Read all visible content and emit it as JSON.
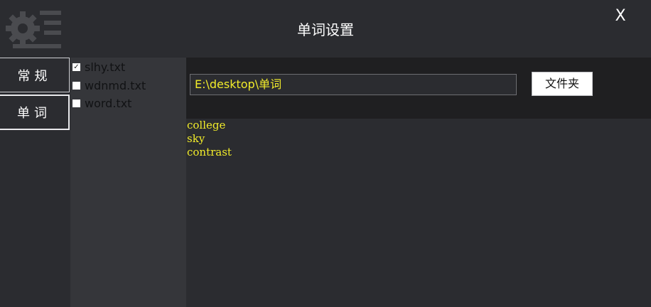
{
  "window": {
    "title": "单词设置",
    "close_label": "X"
  },
  "nav": {
    "tabs": [
      {
        "label": "常规"
      },
      {
        "label": "单词"
      }
    ]
  },
  "files": [
    {
      "name": "slhy.txt",
      "checked": true,
      "check_mark": "✓"
    },
    {
      "name": "wdnmd.txt",
      "checked": false,
      "check_mark": ""
    },
    {
      "name": "word.txt",
      "checked": false,
      "check_mark": ""
    }
  ],
  "folder": {
    "path": "E:\\desktop\\单词",
    "button_label": "文件夹"
  },
  "words": [
    "college",
    "sky",
    "contrast"
  ],
  "colors": {
    "background": "#2b2c30",
    "accent_text": "#f2ec2a",
    "folder_bar": "#1f1f21",
    "file_column": "#35363a"
  }
}
